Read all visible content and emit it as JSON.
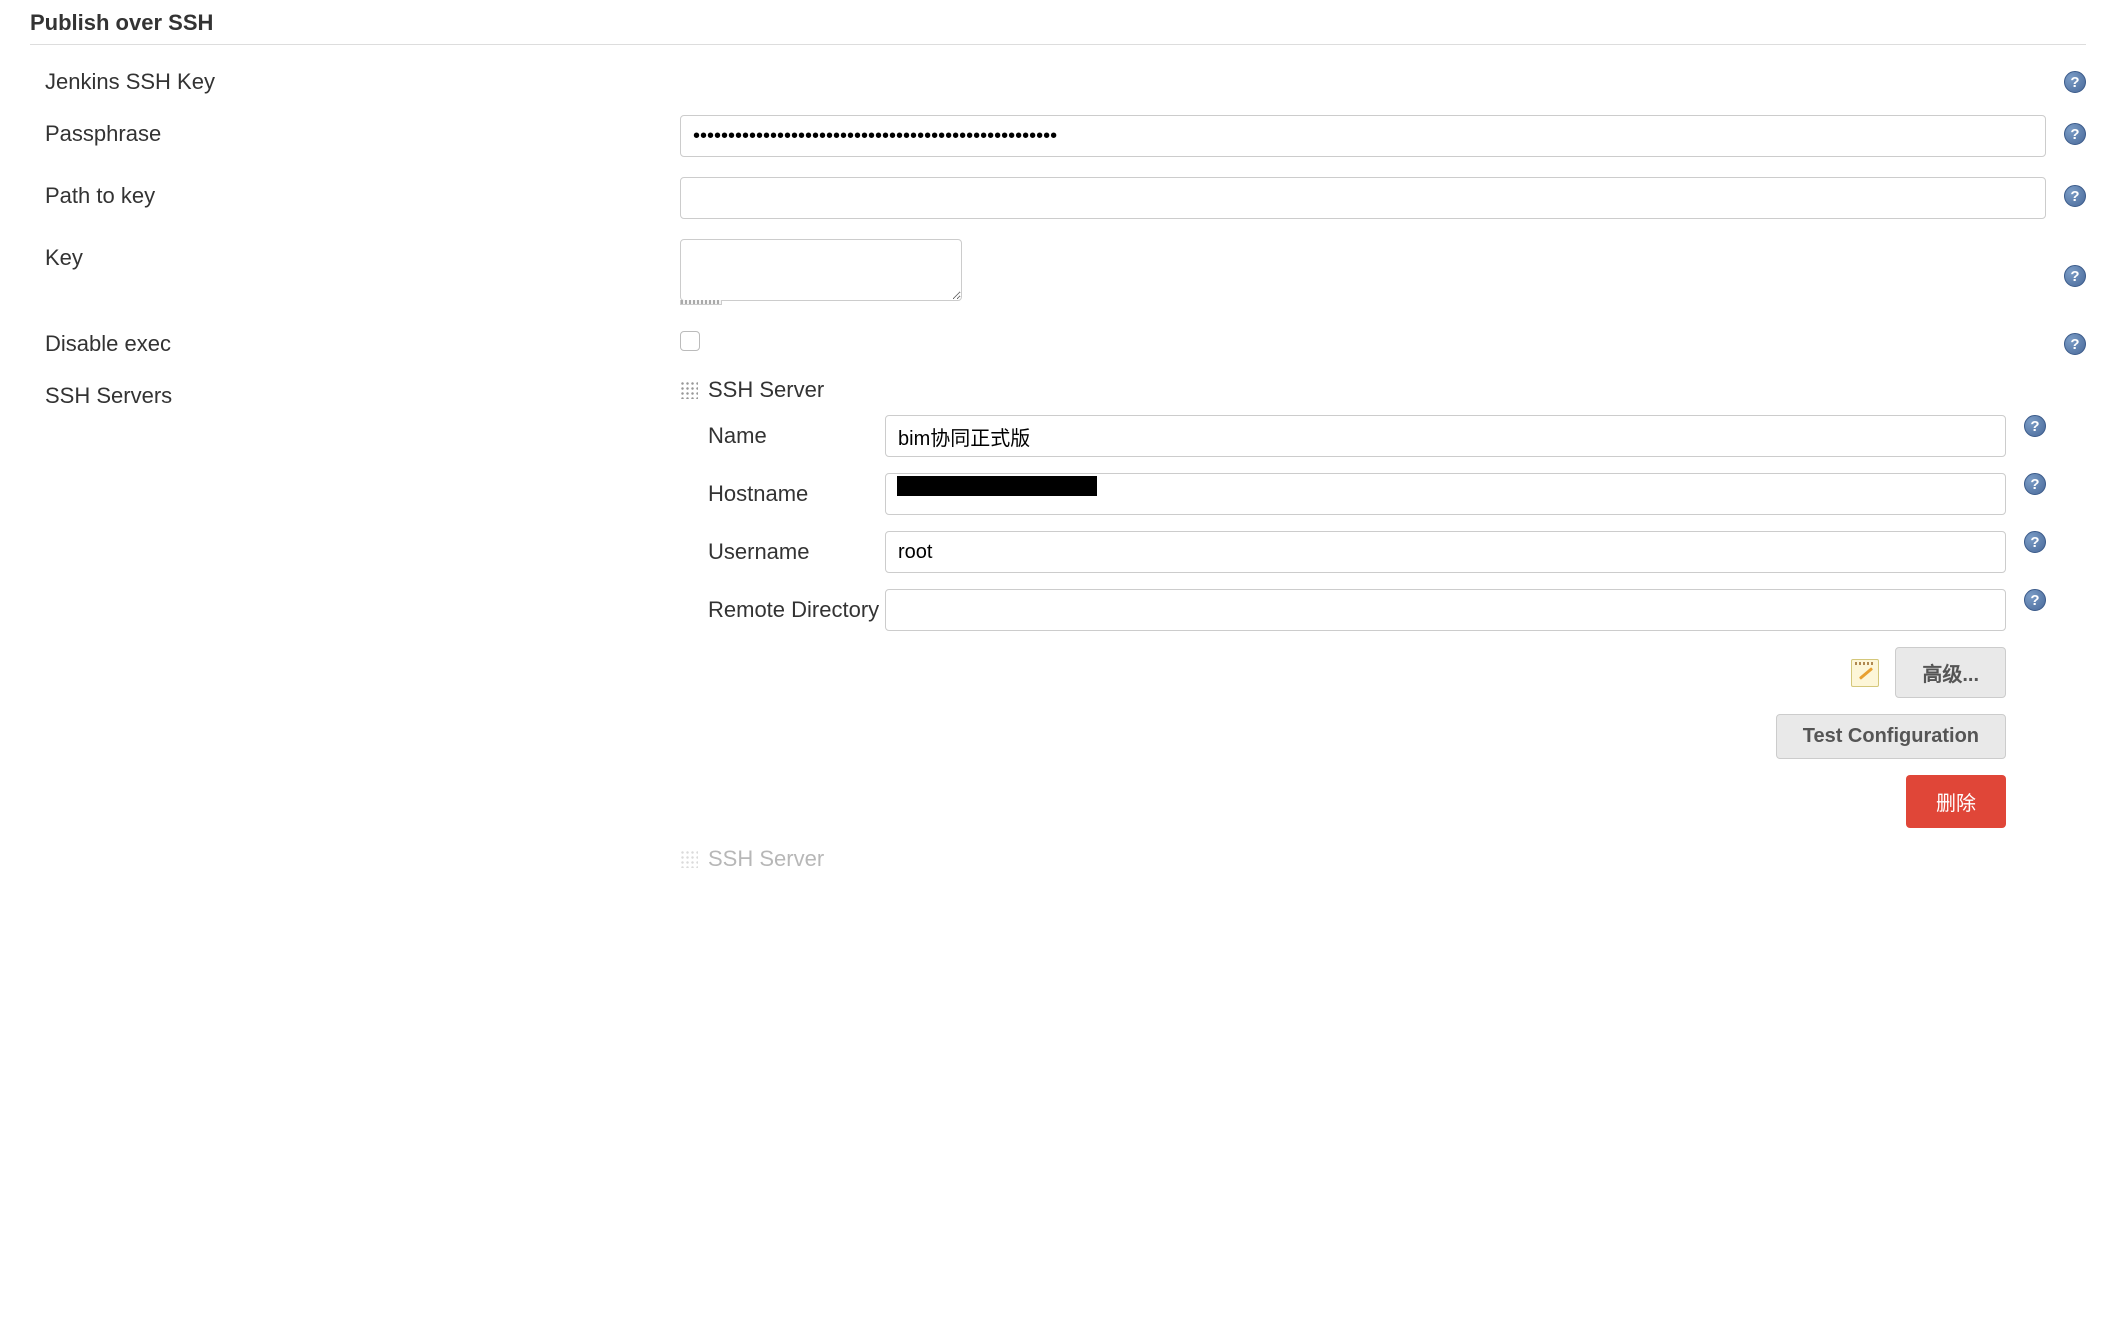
{
  "section_title": "Publish over SSH",
  "labels": {
    "jenkins_ssh_key": "Jenkins SSH Key",
    "passphrase": "Passphrase",
    "path_to_key": "Path to key",
    "key": "Key",
    "disable_exec": "Disable exec",
    "ssh_servers": "SSH Servers"
  },
  "values": {
    "passphrase": "••••••••••••••••••••••••••••••••••••••••••••••••••••",
    "path_to_key": "",
    "key": "",
    "disable_exec": false
  },
  "ssh_server": {
    "header": "SSH Server",
    "labels": {
      "name": "Name",
      "hostname": "Hostname",
      "username": "Username",
      "remote_directory": "Remote Directory"
    },
    "values": {
      "name": "bim协同正式版",
      "hostname": "",
      "username": "root",
      "remote_directory": ""
    }
  },
  "buttons": {
    "advanced": "高级...",
    "test_configuration": "Test Configuration",
    "delete": "删除"
  },
  "ghost_server_label": "SSH Server"
}
